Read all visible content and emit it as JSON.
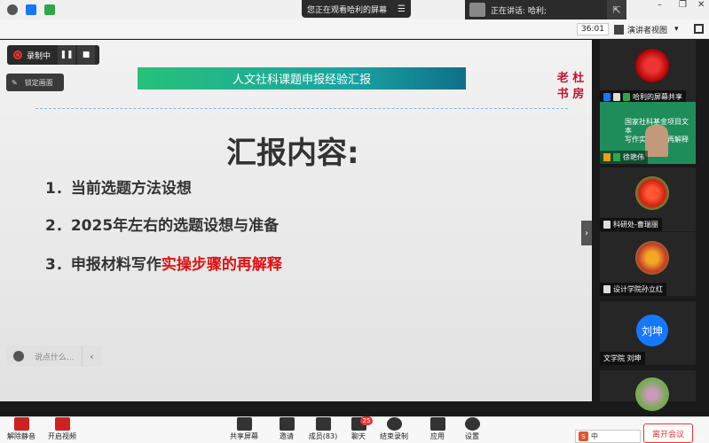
{
  "window": {
    "banner_text": "您正在观看哈利的屏幕",
    "banner_menu": "☰",
    "speaker_label": "正在讲话: 哈利;",
    "min": "–",
    "restore": "❐",
    "close": "✕"
  },
  "status": {
    "timer": "36:01",
    "view_label": "演讲者视图",
    "view_arrow": "▾"
  },
  "recording": {
    "label": "录制中",
    "pause_glyph": "❚❚",
    "stop_glyph": "■"
  },
  "lock_button": "锁定画面",
  "slide": {
    "title": "人文社科课题申报经验汇报",
    "stamp_line1": "老 杜",
    "stamp_line2": "书 房",
    "heading": "汇报内容:",
    "items": [
      {
        "text": "1．当前选题方法设想",
        "highlight": ""
      },
      {
        "text": "2．2025年左右的选题设想与准备",
        "highlight": ""
      },
      {
        "text": "3．申报材料写作",
        "highlight": "实操步骤的再解释"
      }
    ]
  },
  "chat": {
    "placeholder": "说点什么...",
    "arrow": "‹"
  },
  "collapse_glyph": "›",
  "participants": [
    {
      "name": "哈利的屏幕共享"
    },
    {
      "name": "徐艳伟"
    },
    {
      "name": "科研处-曹瑞丽"
    },
    {
      "name": "设计学院孙立红"
    },
    {
      "name": "文学院 刘坤",
      "avatar_text": "刘坤"
    }
  ],
  "share_preview": {
    "line1": "国家社科基金项目文本",
    "line2": "写作实操步骤再解释"
  },
  "toolbar": {
    "mute": "解除静音",
    "video": "开启视频",
    "share": "共享屏幕",
    "invite": "邀请",
    "members": "成员(83)",
    "chat": "聊天",
    "chat_badge": "25",
    "end_record": "结束录制",
    "apps": "应用",
    "settings": "设置",
    "leave": "离开会议"
  },
  "ime": {
    "logo": "S",
    "mode": "中"
  },
  "colors": {
    "accent_red": "#e01010",
    "title_green": "#27c17a",
    "title_teal": "#0f6f88",
    "avatar_blue": "#1677ff"
  }
}
